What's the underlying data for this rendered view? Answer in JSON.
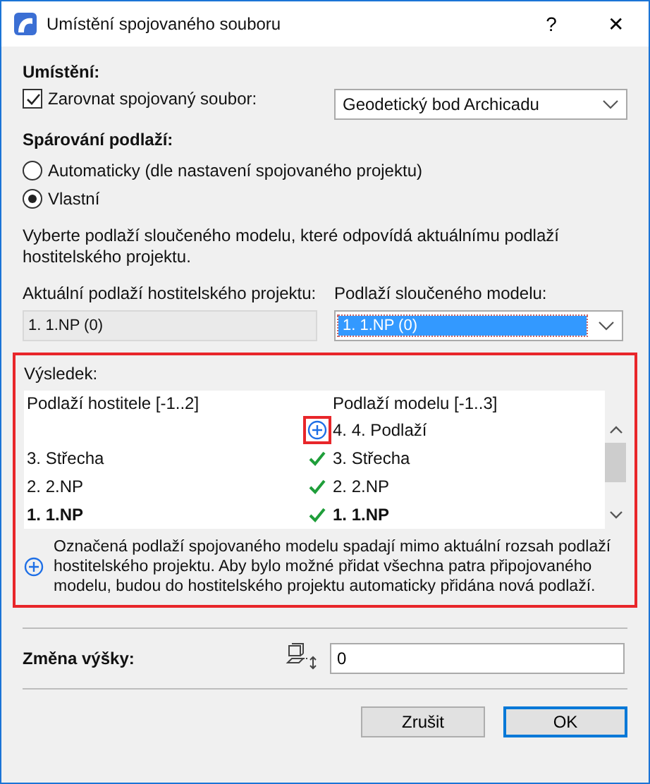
{
  "window": {
    "title": "Umístění spojovaného souboru",
    "help": "?",
    "close": "✕"
  },
  "placement": {
    "heading": "Umístění:",
    "align": {
      "label": "Zarovnat spojovaný soubor:",
      "checked": true
    },
    "align_target": "Geodetický bod Archicadu"
  },
  "story_matching": {
    "heading": "Spárování podlaží:",
    "options": [
      {
        "label": "Automaticky (dle nastavení spojovaného projektu)",
        "selected": false
      },
      {
        "label": "Vlastní",
        "selected": true
      }
    ]
  },
  "description": "Vyberte podlaží sloučeného modelu, které odpovídá aktuálnímu podlaží hostitelského projektu.",
  "host_story": {
    "label": "Aktuální podlaží hostitelského projektu:",
    "value": "1. 1.NP (0)"
  },
  "model_story": {
    "label": "Podlaží sloučeného modelu:",
    "value": "1. 1.NP (0)"
  },
  "result": {
    "heading": "Výsledek:",
    "columns": [
      "Podlaží hostitele [-1..2]",
      "Podlaží modelu [-1..3]"
    ],
    "rows": [
      {
        "host": "",
        "kind": "added",
        "model": "4. 4. Podlaží",
        "current": false
      },
      {
        "host": "3. Střecha",
        "kind": "match",
        "model": "3. Střecha",
        "current": false
      },
      {
        "host": "2. 2.NP",
        "kind": "match",
        "model": "2. 2.NP",
        "current": false
      },
      {
        "host": "1. 1.NP",
        "kind": "match",
        "model": "1. 1.NP",
        "current": true
      }
    ],
    "note": "Označená podlaží spojovaného modelu spadají mimo aktuální rozsah podlaží hostitelského projektu. Aby bylo možné přidat všechna patra připojovaného modelu, budou do hostitelského projektu automaticky přidána nová podlaží."
  },
  "elevation": {
    "label": "Změna výšky:",
    "value": "0"
  },
  "buttons": [
    {
      "label": "Zrušit",
      "default": false
    },
    {
      "label": "OK",
      "default": true
    }
  ]
}
